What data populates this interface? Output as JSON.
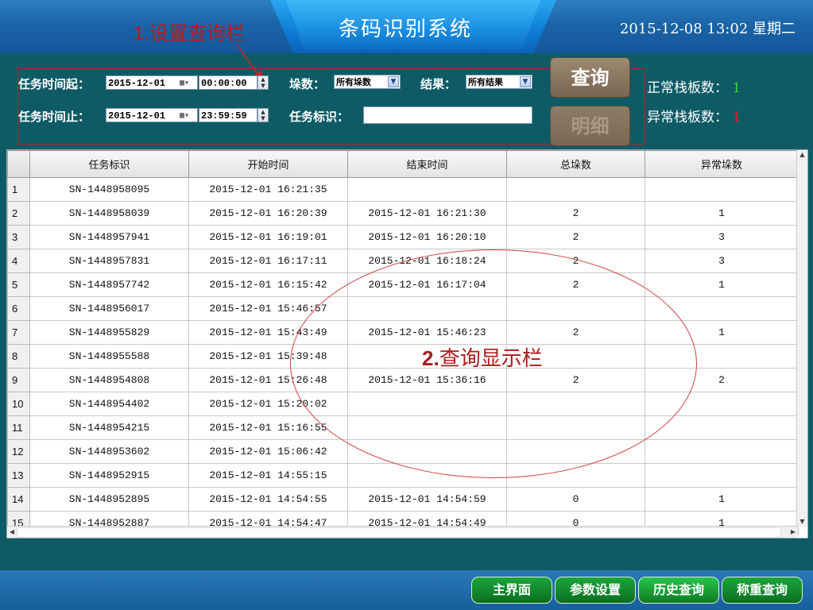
{
  "header": {
    "title": "条码识别系统",
    "datetime": "2015-12-08  13:02  星期二",
    "annotation_num": "1.",
    "annotation_text": "设置查询栏"
  },
  "query": {
    "start_label": "任务时间起：",
    "start_date": "2015-12-01",
    "start_time": "00:00:00",
    "end_label": "任务时间止：",
    "end_date": "2015-12-01",
    "end_time": "23:59:59",
    "count_label": "垛数：",
    "count_value": "所有垛数",
    "result_label": "结果：",
    "result_value": "所有结果",
    "task_id_label": "任务标识：",
    "task_id_value": "",
    "query_button": "查询",
    "detail_button": "明细"
  },
  "stats": {
    "normal_label": "正常栈板数：",
    "normal_value": "1",
    "abnormal_label": "异常栈板数：",
    "abnormal_value": "1"
  },
  "table": {
    "headers": [
      "任务标识",
      "开始时间",
      "结束时间",
      "总垛数",
      "异常垛数"
    ],
    "rows": [
      {
        "n": "1",
        "id": "SN-1448958095",
        "start": "2015-12-01 16:21:35",
        "end": "",
        "total": "",
        "abnormal": ""
      },
      {
        "n": "2",
        "id": "SN-1448958039",
        "start": "2015-12-01 16:20:39",
        "end": "2015-12-01 16:21:30",
        "total": "2",
        "abnormal": "1"
      },
      {
        "n": "3",
        "id": "SN-1448957941",
        "start": "2015-12-01 16:19:01",
        "end": "2015-12-01 16:20:10",
        "total": "2",
        "abnormal": "3"
      },
      {
        "n": "4",
        "id": "SN-1448957831",
        "start": "2015-12-01 16:17:11",
        "end": "2015-12-01 16:18:24",
        "total": "2",
        "abnormal": "3"
      },
      {
        "n": "5",
        "id": "SN-1448957742",
        "start": "2015-12-01 16:15:42",
        "end": "2015-12-01 16:17:04",
        "total": "2",
        "abnormal": "1"
      },
      {
        "n": "6",
        "id": "SN-1448956017",
        "start": "2015-12-01 15:46:57",
        "end": "",
        "total": "",
        "abnormal": ""
      },
      {
        "n": "7",
        "id": "SN-1448955829",
        "start": "2015-12-01 15:43:49",
        "end": "2015-12-01 15:46:23",
        "total": "2",
        "abnormal": "1"
      },
      {
        "n": "8",
        "id": "SN-1448955588",
        "start": "2015-12-01 15:39:48",
        "end": "",
        "total": "",
        "abnormal": ""
      },
      {
        "n": "9",
        "id": "SN-1448954808",
        "start": "2015-12-01 15:26:48",
        "end": "2015-12-01 15:36:16",
        "total": "2",
        "abnormal": "2"
      },
      {
        "n": "10",
        "id": "SN-1448954402",
        "start": "2015-12-01 15:20:02",
        "end": "",
        "total": "",
        "abnormal": ""
      },
      {
        "n": "11",
        "id": "SN-1448954215",
        "start": "2015-12-01 15:16:55",
        "end": "",
        "total": "",
        "abnormal": ""
      },
      {
        "n": "12",
        "id": "SN-1448953602",
        "start": "2015-12-01 15:06:42",
        "end": "",
        "total": "",
        "abnormal": ""
      },
      {
        "n": "13",
        "id": "SN-1448952915",
        "start": "2015-12-01 14:55:15",
        "end": "",
        "total": "",
        "abnormal": ""
      },
      {
        "n": "14",
        "id": "SN-1448952895",
        "start": "2015-12-01 14:54:55",
        "end": "2015-12-01 14:54:59",
        "total": "0",
        "abnormal": "1"
      },
      {
        "n": "15",
        "id": "SN-1448952887",
        "start": "2015-12-01 14:54:47",
        "end": "2015-12-01 14:54:49",
        "total": "0",
        "abnormal": "1"
      }
    ],
    "annotation_num": "2.",
    "annotation_text": "查询显示栏"
  },
  "footer": {
    "buttons": [
      "主界面",
      "参数设置",
      "历史查询",
      "称重查询"
    ]
  }
}
